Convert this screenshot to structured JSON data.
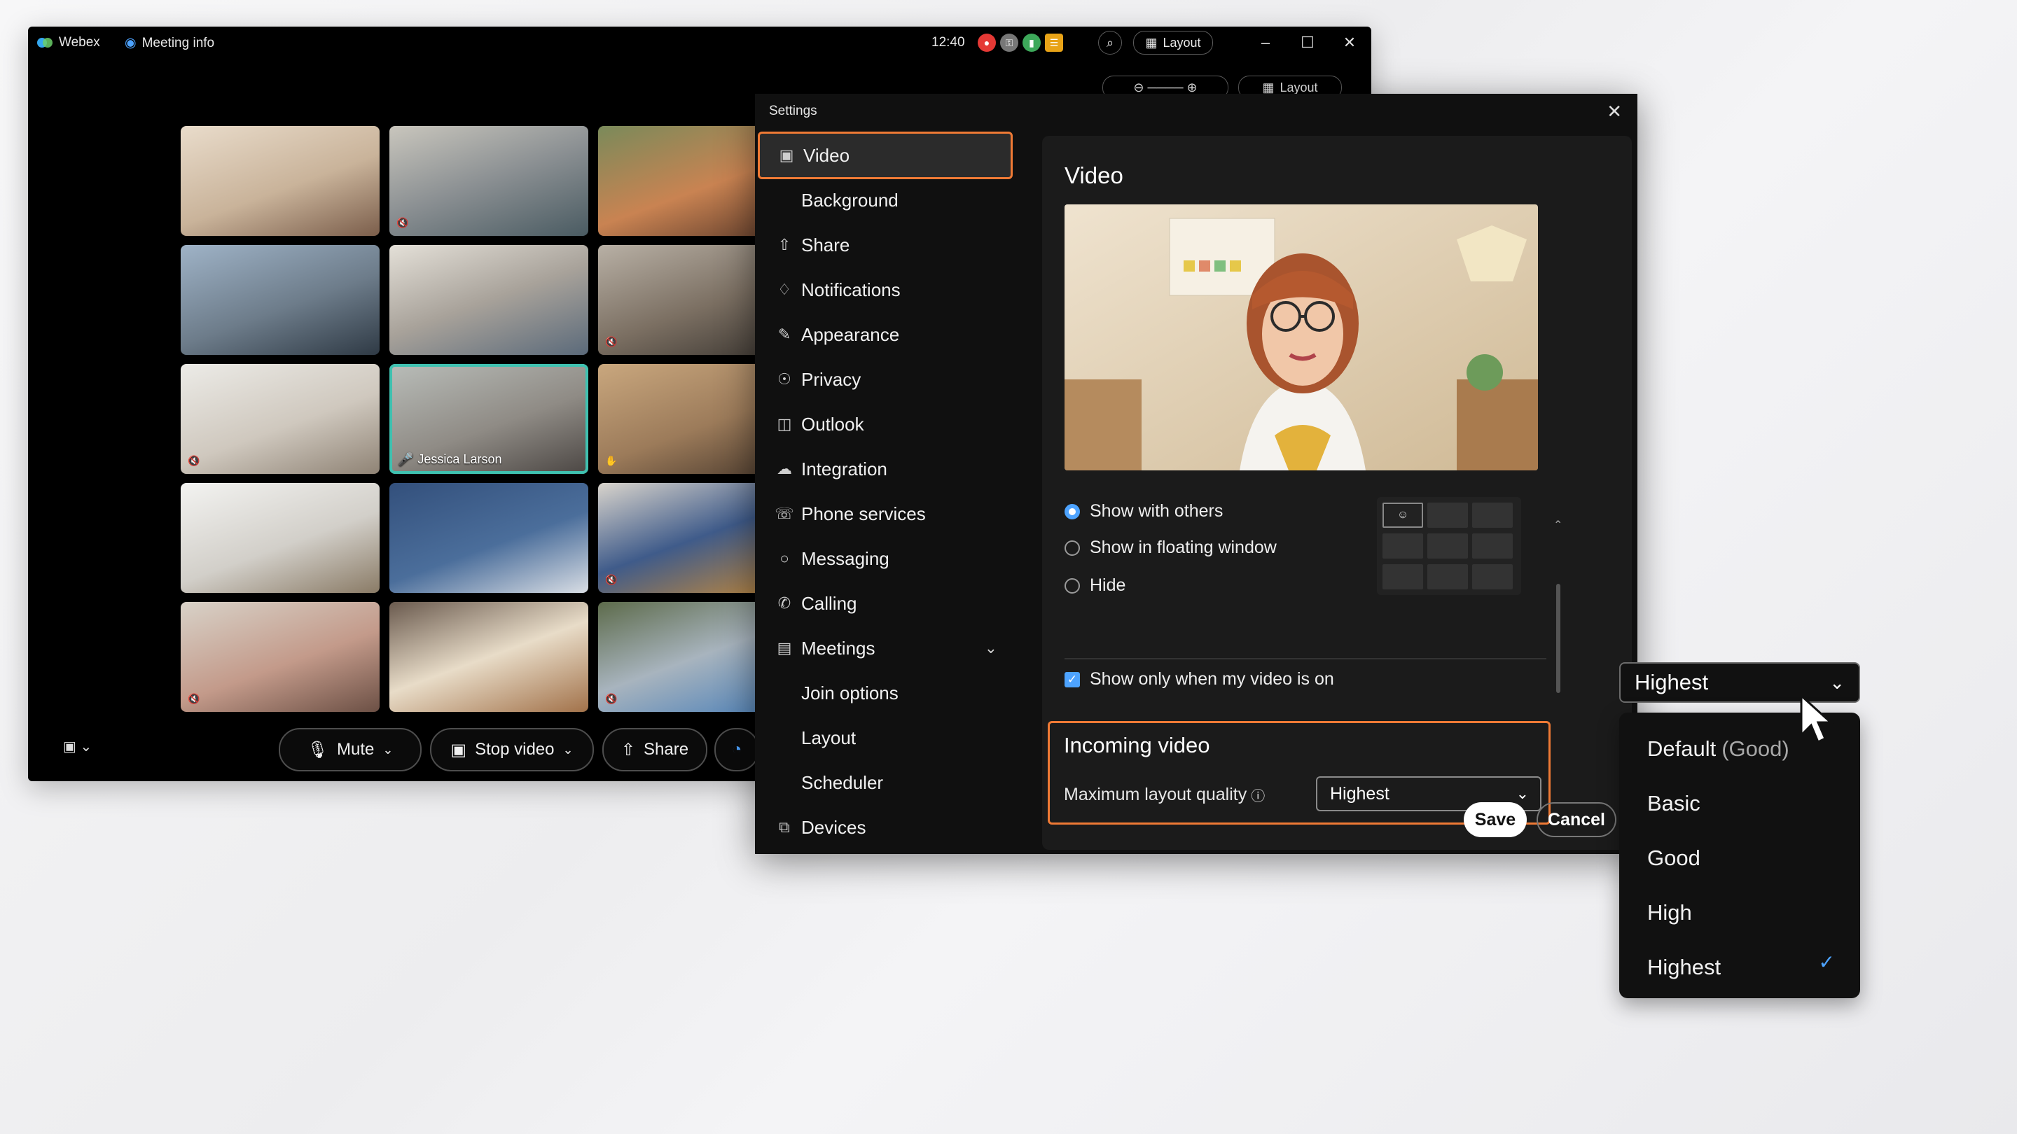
{
  "main_window": {
    "app_name": "Webex",
    "meeting_info": "Meeting info",
    "time": "12:40",
    "layout_label": "Layout",
    "layout_label_behind": "Layout",
    "participants": [
      {
        "name": ""
      },
      {
        "name": ""
      },
      {
        "name": ""
      },
      {
        "name": ""
      },
      {
        "name": ""
      },
      {
        "name": ""
      },
      {
        "name": ""
      },
      {
        "name": "Jessica Larson"
      },
      {
        "name": ""
      },
      {
        "name": ""
      },
      {
        "name": ""
      },
      {
        "name": ""
      },
      {
        "name": ""
      },
      {
        "name": ""
      },
      {
        "name": ""
      }
    ],
    "controls": {
      "mute": "Mute",
      "stop_video": "Stop video",
      "share": "Share"
    }
  },
  "settings": {
    "title": "Settings",
    "nav": [
      {
        "label": "Video",
        "icon": "camera-icon"
      },
      {
        "label": "Background",
        "icon": ""
      },
      {
        "label": "Share",
        "icon": "share-icon"
      },
      {
        "label": "Notifications",
        "icon": "bell-icon"
      },
      {
        "label": "Appearance",
        "icon": "paint-icon"
      },
      {
        "label": "Privacy",
        "icon": "privacy-icon"
      },
      {
        "label": "Outlook",
        "icon": "outlook-icon"
      },
      {
        "label": "Integration",
        "icon": "cloud-icon"
      },
      {
        "label": "Phone services",
        "icon": "phone-services-icon"
      },
      {
        "label": "Messaging",
        "icon": "chat-icon"
      },
      {
        "label": "Calling",
        "icon": "phone-icon"
      },
      {
        "label": "Meetings",
        "icon": "calendar-icon"
      },
      {
        "label": "Join options",
        "icon": ""
      },
      {
        "label": "Layout",
        "icon": ""
      },
      {
        "label": "Scheduler",
        "icon": ""
      },
      {
        "label": "Devices",
        "icon": "devices-icon"
      }
    ],
    "video": {
      "heading": "Video",
      "self_view_options": [
        "Show with others",
        "Show in floating window",
        "Hide"
      ],
      "selected_option": "Show with others",
      "show_only_when_on": "Show only when my video is on",
      "incoming_heading": "Incoming video",
      "max_quality_label": "Maximum layout quality",
      "max_quality_value": "Highest"
    },
    "save": "Save",
    "cancel": "Cancel"
  },
  "dropdown": {
    "selected": "Highest",
    "options": [
      {
        "label": "Default",
        "suffix": "(Good)"
      },
      {
        "label": "Basic",
        "suffix": ""
      },
      {
        "label": "Good",
        "suffix": ""
      },
      {
        "label": "High",
        "suffix": ""
      },
      {
        "label": "Highest",
        "suffix": ""
      }
    ]
  },
  "colors": {
    "accent_orange": "#ef7a35",
    "accent_blue": "#4da3ff",
    "active_speaker": "#3fc1b0"
  }
}
